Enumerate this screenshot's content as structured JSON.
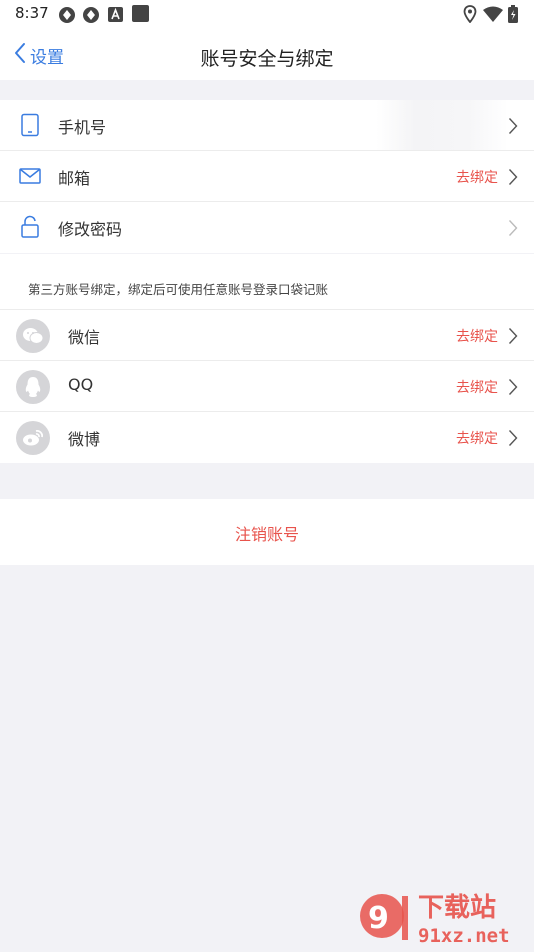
{
  "status_bar": {
    "time": "8:37"
  },
  "nav": {
    "back_label": "设置",
    "title": "账号安全与绑定"
  },
  "account_rows": [
    {
      "label": "手机号",
      "action": ""
    },
    {
      "label": "邮箱",
      "action": "去绑定"
    },
    {
      "label": "修改密码",
      "action": ""
    }
  ],
  "third_party_hint": "第三方账号绑定，绑定后可使用任意账号登录口袋记账",
  "social_rows": [
    {
      "label": "微信",
      "action": "去绑定"
    },
    {
      "label": "QQ",
      "action": "去绑定"
    },
    {
      "label": "微博",
      "action": "去绑定"
    }
  ],
  "cancel_account_label": "注销账号",
  "watermark": {
    "brand": "下载站",
    "domain": "91xz.net"
  },
  "colors": {
    "accent_blue": "#3a7ce0",
    "action_red": "#e8534c",
    "background": "#f2f2f6"
  }
}
